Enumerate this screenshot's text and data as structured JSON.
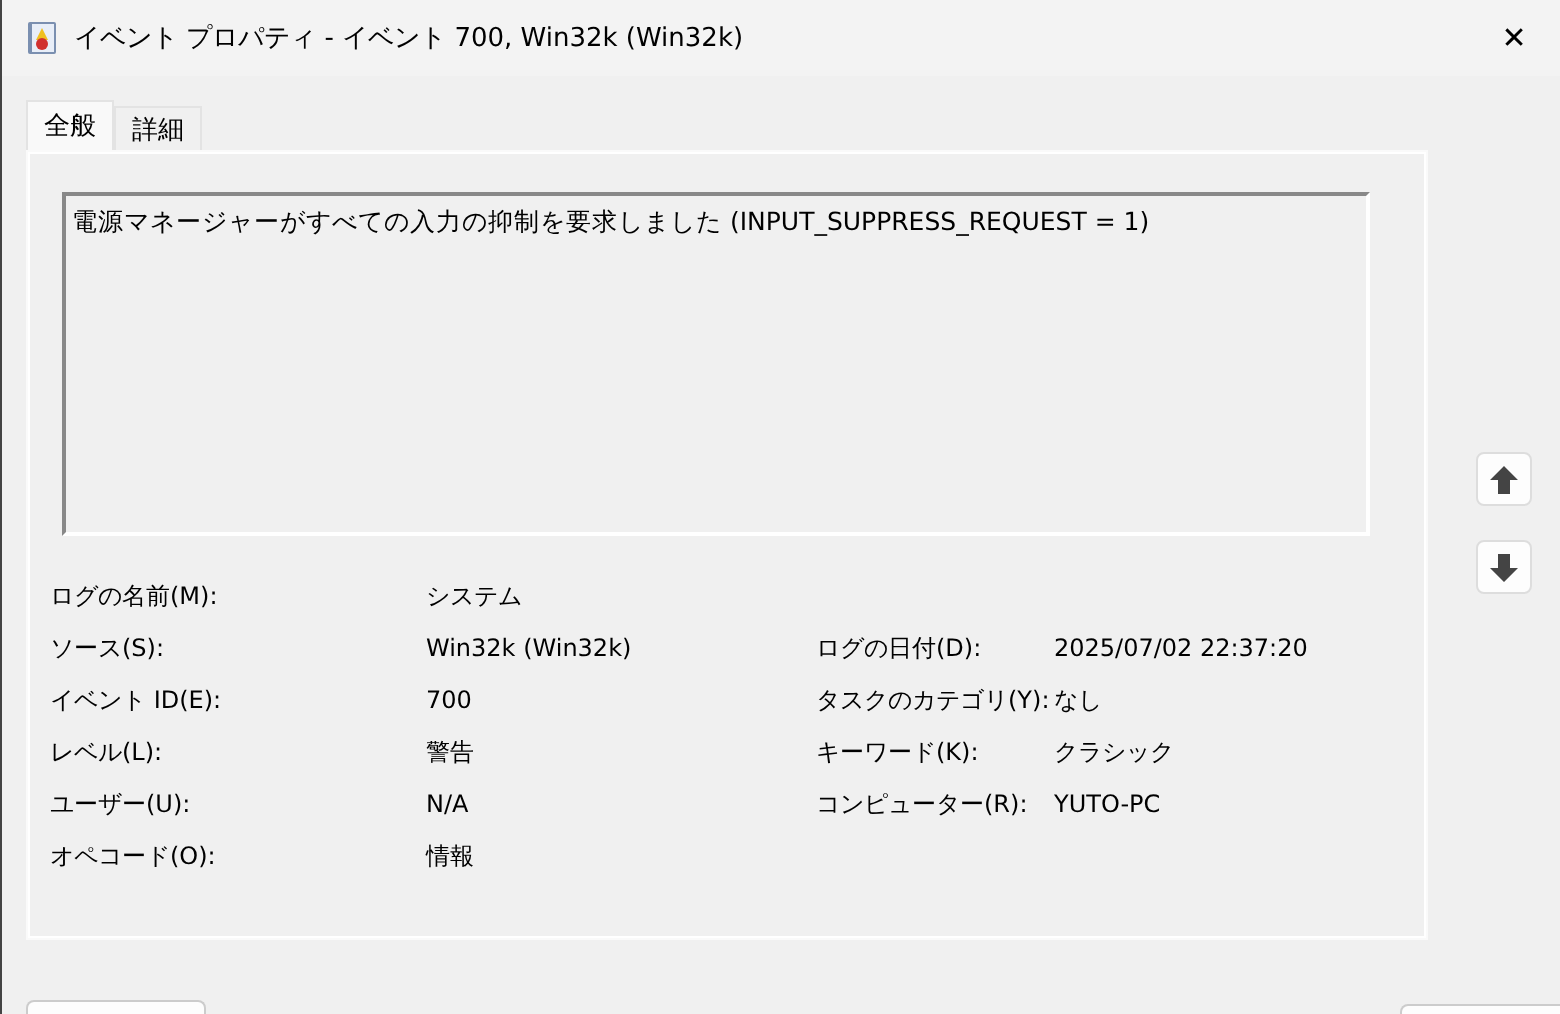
{
  "window": {
    "title": "イベント プロパティ - イベント 700, Win32k (Win32k)",
    "close": "✕"
  },
  "tabs": [
    {
      "label": "全般",
      "selected": true
    },
    {
      "label": "詳細",
      "selected": false
    }
  ],
  "message": "電源マネージャーがすべての入力の抑制を要求しました (INPUT_SUPPRESS_REQUEST = 1)",
  "fields_left": [
    {
      "label": "ログの名前(M):",
      "value": "システム"
    },
    {
      "label": "ソース(S):",
      "value": "Win32k (Win32k)"
    },
    {
      "label": "イベント ID(E):",
      "value": "700"
    },
    {
      "label": "レベル(L):",
      "value": "警告"
    },
    {
      "label": "ユーザー(U):",
      "value": "N/A"
    },
    {
      "label": "オペコード(O):",
      "value": "情報"
    }
  ],
  "fields_right": [
    {
      "label": "ログの日付(D):",
      "value": "2025/07/02 22:37:20"
    },
    {
      "label": "タスクのカテゴリ(Y):",
      "value": "なし"
    },
    {
      "label": "キーワード(K):",
      "value": "クラシック"
    },
    {
      "label": "コンピューター(R):",
      "value": "YUTO-PC"
    }
  ]
}
